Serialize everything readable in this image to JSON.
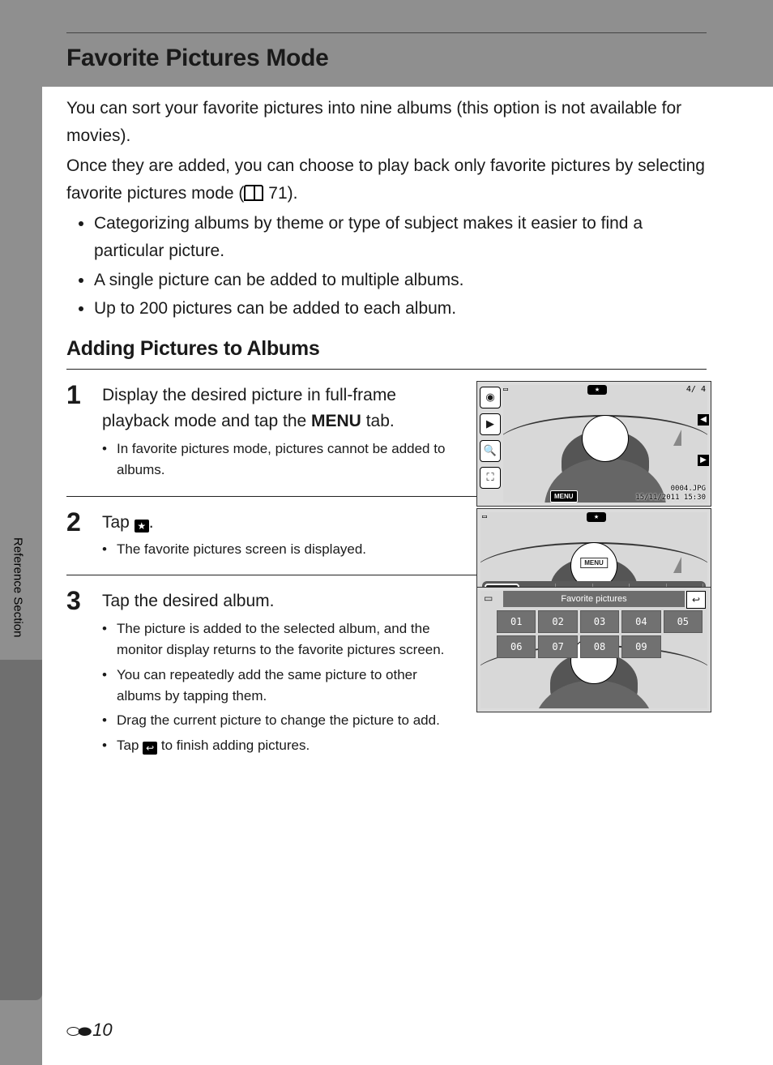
{
  "title": "Favorite Pictures Mode",
  "intro": {
    "p1": "You can sort your favorite pictures into nine albums (this option is not available for movies).",
    "p2_a": "Once they are added, you can choose to play back only favorite pictures by selecting favorite pictures mode (",
    "p2_b": " 71).",
    "bullets": [
      "Categorizing albums by theme or type of subject makes it easier to find a particular picture.",
      "A single picture can be added to multiple albums.",
      "Up to 200 pictures can be added to each album."
    ]
  },
  "section2": "Adding Pictures to Albums",
  "steps": [
    {
      "num": "1",
      "title_a": "Display the desired picture in full-frame playback mode and tap the ",
      "title_menu": "MENU",
      "title_b": " tab.",
      "subs": [
        "In favorite pictures mode, pictures cannot be added to albums."
      ]
    },
    {
      "num": "2",
      "title_a": "Tap ",
      "title_b": ".",
      "subs": [
        "The favorite pictures screen is displayed."
      ]
    },
    {
      "num": "3",
      "title_a": "Tap the desired album.",
      "subs": [
        "The picture is added to the selected album, and the monitor display returns to the favorite pictures screen.",
        "You can repeatedly add the same picture to other albums by tapping them.",
        "Drag the current picture to change the picture to add."
      ],
      "sub_last_a": "Tap ",
      "sub_last_b": " to finish adding pictures."
    }
  ],
  "sidebar_label": "Reference Section",
  "page_number": "10",
  "screen1": {
    "counter": "4/   4",
    "filename": "0004.JPG",
    "datetime": "15/11/2011   15:30",
    "menu": "MENU",
    "side_icons": [
      "camera-icon",
      "play-icon",
      "zoom-icon",
      "expand-icon"
    ]
  },
  "screen2": {
    "menu": "MENU",
    "icons": [
      "star-icon",
      "trash-icon",
      "slideshow-icon",
      "key-icon",
      "print-icon",
      "draw-icon",
      "edit-icon",
      "voice-icon",
      "copy-icon",
      "",
      "",
      "wrench-icon"
    ]
  },
  "screen3": {
    "title": "Favorite pictures",
    "albums": [
      "01",
      "02",
      "03",
      "04",
      "05",
      "06",
      "07",
      "08",
      "09",
      ""
    ]
  }
}
